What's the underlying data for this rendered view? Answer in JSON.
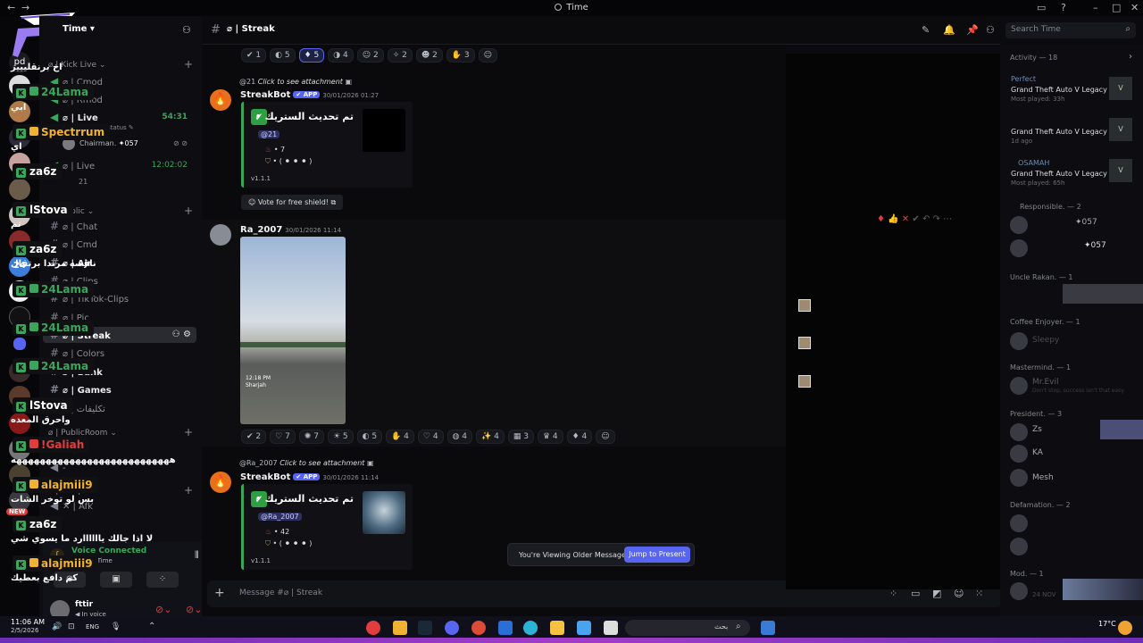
{
  "window": {
    "title": "Time"
  },
  "server": {
    "name": "Time",
    "mention_badge": "331",
    "new_badge": "NEW"
  },
  "sidebar": {
    "cat_kick": "Kick Live",
    "cat_public": "Public",
    "cat_publicroom": "PublicRoom",
    "cat_sleep": "Sleep",
    "voice_cmod": "Cmod",
    "voice_rmod": "Rmod",
    "voice_live1": "Live",
    "voice_live1_time": "54:31",
    "voice_live1_status": "Set a channel status",
    "voice_live1_user": "Chairman.",
    "voice_live1_user_tag": "057",
    "voice_live2": "Live",
    "voice_live2_time": "12:02:02",
    "voice_live2_count": "21",
    "ch_chat": "Chat",
    "ch_cmd": "Cmd",
    "ch_ajr": "Ajr",
    "ch_clips": "Clips",
    "ch_tiktok": "TikTok-Clips",
    "ch_pic": "Pic",
    "ch_streak": "Streak",
    "ch_colors": "Colors",
    "ch_bank": "Bank",
    "ch_games": "Games",
    "ch_arabic": "تكليفات",
    "vroom_g": "G",
    "vroom_dash": "-",
    "vsleep_afk": "Afk"
  },
  "voice_panel": {
    "status": "Voice Connected",
    "location": "Live / Time",
    "user_name": "fttir",
    "user_status": "In voice"
  },
  "chat": {
    "channel_name": "Streak",
    "search_placeholder": "Search Time",
    "input_placeholder": "Message #⌀ | Streak",
    "top_reactions": [
      "1",
      "5",
      "5",
      "4",
      "2",
      "2",
      "2",
      "3"
    ],
    "msg1": {
      "reply_user": "@21",
      "reply_text": "Click to see attachment",
      "author": "StreakBot",
      "app_badge": "APP",
      "timestamp": "30/01/2026 01:27",
      "embed_title": "تم تحديث الستريك •",
      "mention": "@21",
      "line1": "• 7",
      "line2": "• ( ⚫ ⚫ ⚫ )",
      "version": "v1.1.1",
      "button": "Vote for free shield!"
    },
    "msg2": {
      "author": "Ra_2007",
      "timestamp": "30/01/2026 11:14",
      "photo_caption_time": "12:18 PM",
      "photo_caption_place": "Sharjah",
      "reactions": [
        "2",
        "7",
        "7",
        "5",
        "5",
        "4",
        "4",
        "4",
        "4",
        "3",
        "4",
        "4"
      ]
    },
    "msg3": {
      "reply_user": "@Ra_2007",
      "reply_text": "Click to see attachment",
      "author": "StreakBot",
      "app_badge": "APP",
      "timestamp": "30/01/2026 11:14",
      "embed_title": "تم تحديث الستريك •",
      "mention": "@Ra_2007",
      "line1": "• 42",
      "line2": "• ( ⚫ ⚫ ⚫ )",
      "version": "v1.1.1"
    },
    "older_banner": "You're Viewing Older Messages",
    "jump_button": "Jump to Present"
  },
  "overlay_feed": [
    {
      "type": "msg",
      "text": "اخ برنقليييز"
    },
    {
      "type": "name",
      "name": "24Lama",
      "color": "#3ba55d"
    },
    {
      "type": "msg",
      "text": "ابي"
    },
    {
      "type": "name",
      "name": "Spectrrum",
      "color": "#f0b232"
    },
    {
      "type": "msg",
      "text": "اي"
    },
    {
      "type": "name",
      "name": "za6z",
      "color": ""
    },
    {
      "type": "name",
      "name": "lStova",
      "color": ""
    },
    {
      "type": "msg",
      "text": "تم"
    },
    {
      "type": "name",
      "name": "za6z",
      "color": ""
    },
    {
      "type": "msg",
      "text": "ناقصه مرندا برتقال"
    },
    {
      "type": "name",
      "name": "24Lama",
      "color": "#3ba55d"
    },
    {
      "type": "name",
      "name": "24Lama",
      "color": "#3ba55d"
    },
    {
      "type": "name",
      "name": "24Lama",
      "color": "#3ba55d"
    },
    {
      "type": "name",
      "name": "lStova",
      "color": ""
    },
    {
      "type": "msg",
      "text": "واحرق المعده"
    },
    {
      "type": "name",
      "name": "!Galiah",
      "color": "#e23d3d"
    },
    {
      "type": "msg",
      "text": "هههههههههههههههههههههههههههه"
    },
    {
      "type": "name",
      "name": "alajmiii9",
      "color": "#f0b232"
    },
    {
      "type": "msg",
      "text": "بس لو توخر الشات"
    },
    {
      "type": "name",
      "name": "za6z",
      "color": ""
    },
    {
      "type": "msg",
      "text": "لا اذا جالك ياااااارد ما يسوي شي"
    },
    {
      "type": "name",
      "name": "alajmiii9",
      "color": "#f0b232"
    },
    {
      "type": "msg",
      "text": "كم دافع بعطيك"
    }
  ],
  "members": {
    "activity_label": "Activity — 18",
    "game1_title": "Perfect",
    "game": "Grand Theft Auto V Legacy",
    "game1_sub": "Most played: 33h",
    "game2_sub": "1d ago",
    "game3_title": "OSAMAH",
    "game3_sub": "Most played: 65h",
    "cat_responsible": "Responsible. — 2",
    "resp_tag1": "057",
    "resp_tag2": "057",
    "cat_uncle": "Uncle Rakan. — 1",
    "cat_coffee": "Coffee Enjoyer. — 1",
    "coffee_member": "Sleepy",
    "cat_mastermind": "Mastermind. — 1",
    "mastermind_member": "Mr.Evil",
    "mastermind_status": "Don't stop, success isn't that easy",
    "cat_president": "President. — 3",
    "pres1": "Zs",
    "pres2": "KA",
    "pres3": "Mesh",
    "cat_defamation": "Defamation. — 2",
    "cat_mod": "Mod. — 1",
    "mod_date": "24 NOV"
  },
  "taskbar": {
    "time": "11:06 AM",
    "date": "2/5/2026",
    "lang": "ENG",
    "search": "بحث",
    "temp": "17°C"
  }
}
